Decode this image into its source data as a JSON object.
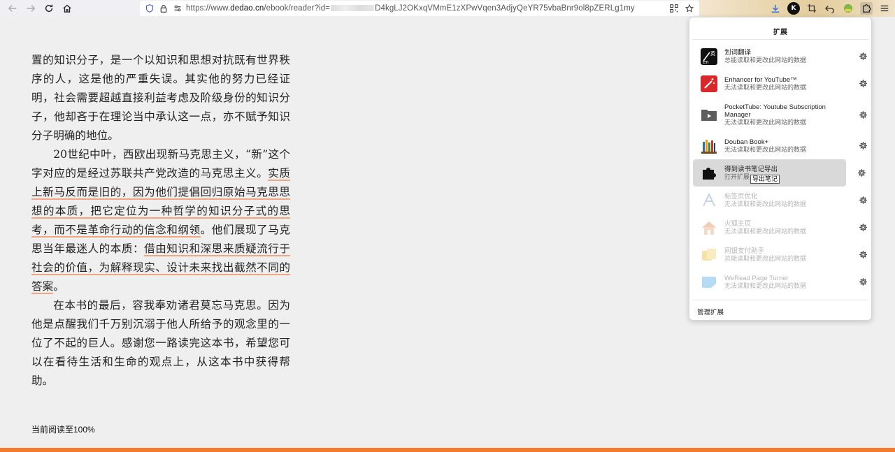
{
  "browser": {
    "url_prefix": "https://www.",
    "url_domain": "dedao.cn",
    "url_path": "/ebook/reader?id=",
    "url_suffix": "D4kgLJ2OKxqVMmE1zXPwVqen3AdjyQeYR75vbaBnr9ol8pZERLg1my"
  },
  "reader": {
    "paragraphs": [
      {
        "indent": false,
        "segments": [
          {
            "text": "置的知识分子，是一个以知识和思想对抗既有世界秩序的人，这是他的严重失误。其实他的努力已经证明，社会需要超越直接利益考虑及阶级身份的知识分子，他却吝于在理论当中承认这一点，亦不赋予知识分子明确的地位。",
            "hl": false
          }
        ]
      },
      {
        "indent": true,
        "segments": [
          {
            "text": "20世纪中叶，西欧出现新马克思主义，“新”这个字对应的是经过苏联共产党改造的马克思主义。",
            "hl": false
          },
          {
            "text": "实质上新马反而是旧的，因为他们提倡回归原始马克思思想的本质，把它定位为一种哲学的知识分子式的思考，而不是革命行动的信念和纲领",
            "hl": true
          },
          {
            "text": "。他们展现了马克思当年最迷人的本质：",
            "hl": false
          },
          {
            "text": "借由知识和深思来质疑流行于社会的价值，为解释现实、设计未来找出截然不同的答案",
            "hl": true
          },
          {
            "text": "。",
            "hl": false
          }
        ]
      },
      {
        "indent": true,
        "segments": [
          {
            "text": "在本书的最后，容我奉劝诸君莫忘马克思。因为他是点醒我们千万别沉溺于他人所给予的观念里的一位了不起的巨人。感谢您一路读完这本书，希望您可以在看待生活和生命的观点上，从这本书中获得帮助。",
            "hl": false
          }
        ]
      }
    ],
    "progress_text": "当前阅读至100%",
    "progress_percent": 100
  },
  "extensions_panel": {
    "title": "扩展",
    "manage_label": "管理扩展",
    "items": [
      {
        "name": "划词翻译",
        "desc": "总能读取和更改此网站的数据",
        "icon": "translate-icon",
        "disabled": false
      },
      {
        "name": "Enhancer for YouTube™",
        "desc": "无法读取和更改此网站的数据",
        "icon": "magic-wand-icon",
        "disabled": false
      },
      {
        "name": "PocketTube: Youtube Subscription Manager",
        "desc": "无法读取和更改此网站的数据",
        "icon": "folder-play-icon",
        "disabled": false
      },
      {
        "name": "Douban Book+",
        "desc": "无法读取和更改此网站的数据",
        "icon": "bookshelf-icon",
        "disabled": false
      },
      {
        "name": "得到读书笔记导出",
        "desc": "打开扩展",
        "icon": "puzzle-icon",
        "disabled": false,
        "tooltip": "导出笔记"
      },
      {
        "name": "标签页优化",
        "desc": "无法读取和更改此网站的数据",
        "icon": "tab-icon",
        "disabled": true
      },
      {
        "name": "火狐主页",
        "desc": "无法读取和更改此网站的数据",
        "icon": "home-icon",
        "disabled": true
      },
      {
        "name": "网银支付助手",
        "desc": "总能读取和更改此网站的数据",
        "icon": "payment-icon",
        "disabled": true
      },
      {
        "name": "WeRead Page Turner",
        "desc": "无法读取和更改此网站的数据",
        "icon": "page-turner-icon",
        "disabled": true
      }
    ]
  }
}
